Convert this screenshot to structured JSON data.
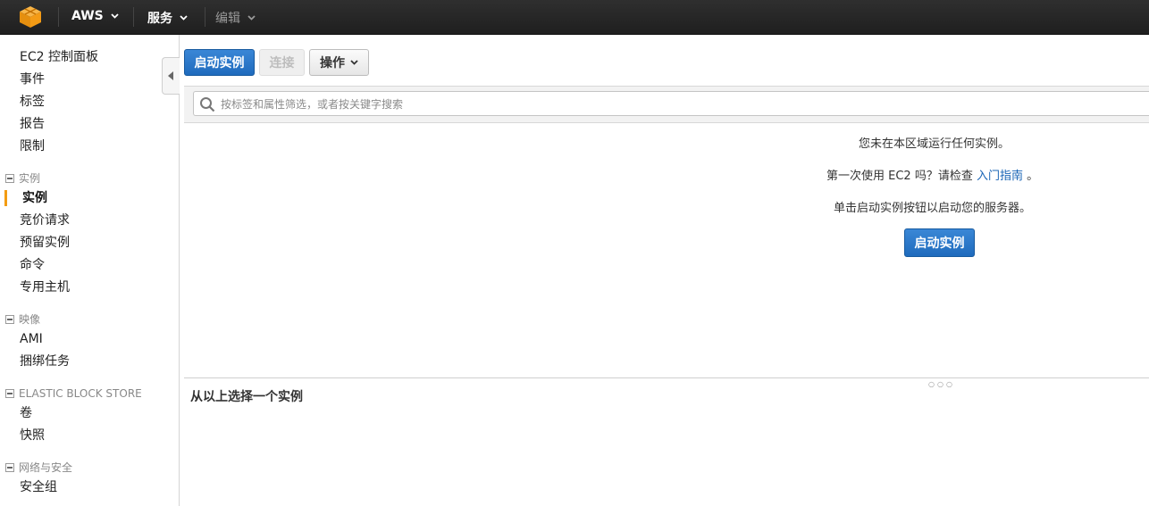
{
  "topbar": {
    "brand": "AWS",
    "services": "服务",
    "edit": "编辑"
  },
  "sidebar": {
    "top_items": [
      "EC2 控制面板",
      "事件",
      "标签",
      "报告",
      "限制"
    ],
    "sections": [
      {
        "title": "实例",
        "items": [
          "实例",
          "竞价请求",
          "预留实例",
          "命令",
          "专用主机"
        ],
        "active_index": 0
      },
      {
        "title": "映像",
        "items": [
          "AMI",
          "捆绑任务"
        ]
      },
      {
        "title": "ELASTIC BLOCK STORE",
        "items": [
          "卷",
          "快照"
        ]
      },
      {
        "title": "网络与安全",
        "items": [
          "安全组"
        ]
      }
    ]
  },
  "toolbar": {
    "launch_label": "启动实例",
    "connect_label": "连接",
    "actions_label": "操作"
  },
  "filter": {
    "placeholder": "按标签和属性筛选，或者按关键字搜索"
  },
  "empty_state": {
    "line1": "您未在本区域运行任何实例。",
    "line2_prefix": "第一次使用 EC2 吗？请检查",
    "line2_link": "入门指南",
    "line2_suffix": "。",
    "line3": "单击启动实例按钮以启动您的服务器。",
    "launch_button": "启动实例"
  },
  "detail_pane": {
    "title": "从以上选择一个实例"
  },
  "colors": {
    "topbar": "#232323",
    "primary_button": "#1f6bbd",
    "active_marker": "#f39c12",
    "link": "#1a65b6",
    "logo": "#f7a21b"
  }
}
